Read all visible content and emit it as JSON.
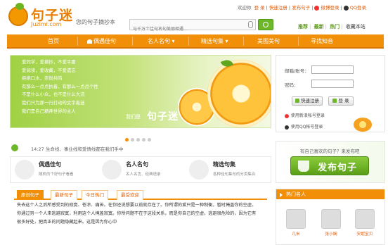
{
  "logo": {
    "name": "句子迷",
    "en": "Juzimi.com",
    "slogan": "您的句子摘抄本"
  },
  "search": {
    "placeholder": "与千万个佳句名句美丽相遇..."
  },
  "top_bar": {
    "welcome": "欢迎你",
    "login": "登 录",
    "quick_register": "快速注册",
    "publish": "发布句子",
    "weibo_login": "微博登录",
    "qq_login": "QQ登录"
  },
  "sub_links": {
    "recommend": "推荐",
    "latest": "最新",
    "hot": "热门",
    "favorite": "收藏本站"
  },
  "nav": {
    "items": [
      "首页",
      "偶遇佳句",
      "名人名句",
      "精选句集",
      "美图美句",
      "寻找知音"
    ]
  },
  "banner": {
    "lines": [
      "爱同学，爱摘抄，不爱平庸",
      "爱阅读，爱收藏，不爱遗忘",
      "拒绝口水，崇尚共鸣",
      "有那么一点点执着，有那么一点点个性",
      "不是什么小众，也不是什么大流",
      "我们只为那一行打动的文字着迷",
      "我们是自己精神世界的主人"
    ],
    "tag": "我们是",
    "brand": "句子迷",
    "active_slide": 1,
    "slide_count": 5
  },
  "login_box": {
    "email_label": "邮箱/账号：",
    "password_label": "密码：",
    "register_btn": "快速注册",
    "login_btn": "登 录",
    "weibo": "使用新浪帐号登录",
    "qq": "使用QQ帐号登录"
  },
  "info_bar": {
    "time": "14:27",
    "text": "生命线、事业线和爱情线都在我们手中"
  },
  "cards": [
    {
      "title": "偶遇佳句",
      "desc": "随机的个好句子看看"
    },
    {
      "title": "名人名句",
      "desc": "名人名言、经典语录"
    },
    {
      "title": "精选句集",
      "desc": "各种佳句集句的分类集合"
    }
  ],
  "tabs": [
    "原创句子",
    "最新句子",
    "今日热门",
    "最受欢迎"
  ],
  "article": {
    "text": "失去这个人之后所感受到的寂寞、苍凉、痛苦。在你还说想要以前就存在了。你所谓的爱只是一种制衡，暂时掩盖你的空虚。你通过另一个人来逃避寂寞，利用这个人掩盖寂寞。你所问题不在于这段关系，而是你自己的空虚。逃避很危险的，因为它有很多好处，把真正的问题隐藏起来。这是因为你心中"
  },
  "publish_box": {
    "question": "有自己喜欢的句子？来发布吧",
    "button": "发布句子"
  },
  "people": {
    "title": "热门名人",
    "list": [
      "几米",
      "张小娴",
      "安妮宝贝"
    ]
  }
}
